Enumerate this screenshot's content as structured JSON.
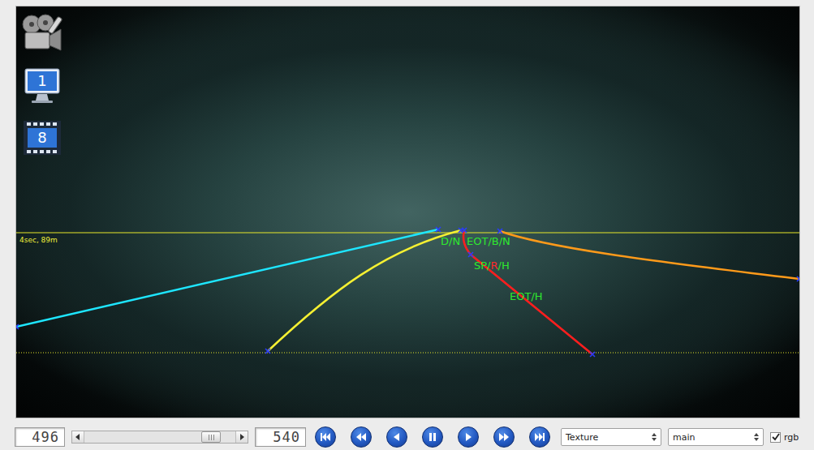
{
  "toolbar": [
    {
      "kind": "clapper"
    },
    {
      "kind": "monitor",
      "badge": "1"
    },
    {
      "kind": "film",
      "badge": "8"
    }
  ],
  "video": {
    "horizon_label": "4sec, 89m",
    "lanes": [
      {
        "color": "#1ee6ff"
      },
      {
        "color": "#f5f032"
      },
      {
        "color": "#ff1e1e"
      },
      {
        "color": "#ff9a1a"
      }
    ],
    "labels": [
      {
        "segments": [
          {
            "text": "D/N",
            "color": "#2ee82e"
          }
        ]
      },
      {
        "segments": [
          {
            "text": "EOT/B/N",
            "color": "#2ee82e"
          }
        ]
      },
      {
        "segments": [
          {
            "text": "SP/",
            "color": "#2ee82e"
          },
          {
            "text": "R",
            "color": "#ff2a2a"
          },
          {
            "text": "/H",
            "color": "#2ee82e"
          }
        ]
      },
      {
        "segments": [
          {
            "text": "EOT/H",
            "color": "#2ee82e"
          }
        ]
      }
    ]
  },
  "controls": {
    "frame_start": "496",
    "slider": {
      "level": 0.84
    },
    "frame_end": "540",
    "buttons": [
      {
        "kind": "first"
      },
      {
        "kind": "rewind"
      },
      {
        "kind": "back"
      },
      {
        "kind": "pause"
      },
      {
        "kind": "play"
      },
      {
        "kind": "forward"
      },
      {
        "kind": "last"
      }
    ],
    "selects": [
      {
        "value": "Texture"
      },
      {
        "value": "main"
      }
    ],
    "checkbox": {
      "label": "rgb",
      "checked": true
    }
  }
}
